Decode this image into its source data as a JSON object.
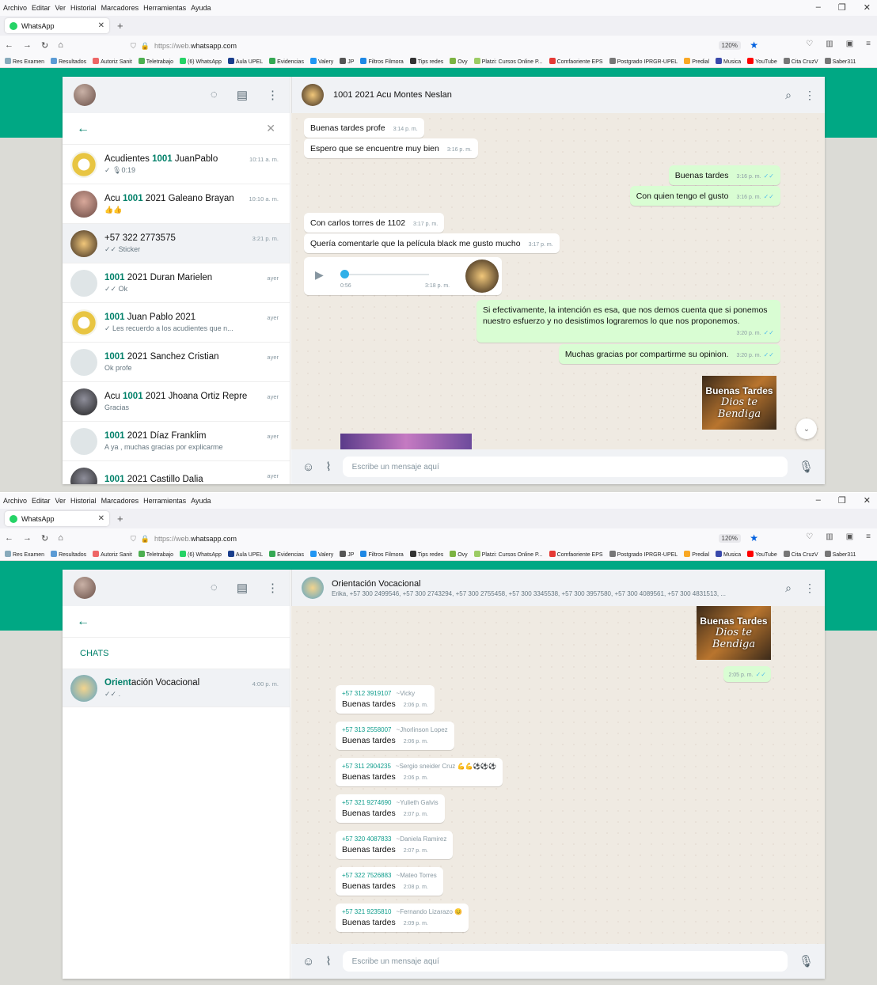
{
  "browser": {
    "menu": [
      "Archivo",
      "Editar",
      "Ver",
      "Historial",
      "Marcadores",
      "Herramientas",
      "Ayuda"
    ],
    "tab_title": "WhatsApp",
    "url_prefix": "https://web.",
    "url_host": "whatsapp.com",
    "zoom": "120%",
    "bookmarks": [
      "Res Examen",
      "Resultados",
      "Autoriz Sanit",
      "Teletrabajo",
      "(6) WhatsApp",
      "Aula UPEL",
      "Evidencias",
      "Valery",
      "JP",
      "Filtros Filmora",
      "Tips redes",
      "Ovy",
      "Platzi: Cursos Online P...",
      "Comfaoriente EPS",
      "Postgrado IPRGR-UPEL",
      "Predial",
      "Musica",
      "YouTube",
      "Cita CruzV",
      "Saber311"
    ]
  },
  "screen1": {
    "chats": [
      {
        "pre": "Acudientes ",
        "hl": "1001",
        "post": " JuanPablo",
        "preview": "✓ 🎙0:19",
        "time": "10:11 a. m.",
        "av": "logo"
      },
      {
        "pre": "Acu ",
        "hl": "1001",
        "post": " 2021 Galeano Brayan",
        "preview": "👍👍",
        "time": "10:10 a. m.",
        "av": "photo"
      },
      {
        "pre": "+57 322 2773575",
        "hl": "",
        "post": "",
        "preview": "✓✓ Sticker",
        "time": "3:21 p. m.",
        "av": "poster",
        "sel": true
      },
      {
        "pre": "",
        "hl": "1001",
        "post": " 2021 Duran Marielen",
        "preview": "✓✓ Ok",
        "time": "ayer",
        "av": "blank"
      },
      {
        "pre": "",
        "hl": "1001",
        "post": " Juan Pablo 2021",
        "preview": "✓ Les recuerdo a los acudientes que n...",
        "time": "ayer",
        "av": "logo"
      },
      {
        "pre": "",
        "hl": "1001",
        "post": " 2021 Sanchez Cristian",
        "preview": "Ok profe",
        "time": "ayer",
        "av": "blank"
      },
      {
        "pre": "Acu ",
        "hl": "1001",
        "post": " 2021 Jhoana Ortiz Repre",
        "preview": "Gracias",
        "time": "ayer",
        "av": "dark"
      },
      {
        "pre": "",
        "hl": "1001",
        "post": " 2021 Díaz Franklim",
        "preview": "A ya , muchas gracias por explicarme",
        "time": "ayer",
        "av": "blank"
      },
      {
        "pre": "",
        "hl": "1001",
        "post": " 2021 Castillo Dalia",
        "preview": "",
        "time": "ayer",
        "av": "dark"
      }
    ],
    "contact": "1001 2021 Acu Montes Neslan",
    "messages": {
      "m1": {
        "text": "Buenas tardes profe",
        "time": "3:14 p. m."
      },
      "m2": {
        "text": "Espero que se encuentre muy bien",
        "time": "3:16 p. m."
      },
      "m3": {
        "text": "Buenas tardes",
        "time": "3:16 p. m."
      },
      "m4": {
        "text": "Con quien tengo el gusto",
        "time": "3:16 p. m."
      },
      "m5": {
        "text": "Con carlos torres de 1102",
        "time": "3:17 p. m."
      },
      "m6": {
        "text": "Quería comentarle que la película black me gusto mucho",
        "time": "3:17 p. m."
      },
      "audio": {
        "duration": "0:56",
        "time": "3:18 p. m."
      },
      "m7": {
        "text": "Si efectivamente, la intención es esa, que nos demos cuenta que si ponemos nuestro esfuerzo y no desistimos lograremos lo que nos proponemos.",
        "time": "3:20 p. m."
      },
      "m8": {
        "text": "Muchas gracias por compartirme su opinion.",
        "time": "3:20 p. m."
      }
    },
    "sticker": {
      "line1": "Buenas Tardes",
      "line2": "Dios te",
      "line3": "Bendiga"
    },
    "compose_placeholder": "Escribe un mensaje aquí"
  },
  "screen2": {
    "chats_label": "CHATS",
    "chat": {
      "hl": "Orient",
      "post": "ación Vocacional",
      "preview": "✓✓ .",
      "time": "4:00 p. m."
    },
    "group_title": "Orientación Vocacional",
    "group_members": "Erika, +57 300 2499546, +57 300 2743294, +57 300 2755458, +57 300 3345538, +57 300 3957580, +57 300 4089561, +57 300 4831513, ...",
    "sticker_time": "2:05 p. m.",
    "messages": [
      {
        "phone": "+57 312 3919107",
        "name": "~Vicky",
        "text": "Buenas tardes",
        "time": "2:06 p. m."
      },
      {
        "phone": "+57 313 2558007",
        "name": "~Jhorlinson Lopez",
        "text": "Buenas  tardes",
        "time": "2:06 p. m."
      },
      {
        "phone": "+57 311 2904235",
        "name": "~Sergio sneider Cruz 💪💪⚽⚽⚽",
        "text": "Buenas tardes",
        "time": "2:06 p. m."
      },
      {
        "phone": "+57 321 9274690",
        "name": "~Yulieth Galvis",
        "text": "Buenas tardes",
        "time": "2:07 p. m."
      },
      {
        "phone": "+57 320 4087833",
        "name": "~Daniela Ramirez",
        "text": "Buenas tardes",
        "time": "2:07 p. m."
      },
      {
        "phone": "+57 322 7526883",
        "name": "~Mateo Torres",
        "text": "Buenas tardes",
        "time": "2:08 p. m."
      },
      {
        "phone": "+57 321 9235810",
        "name": "~Fernando Lizarazo 😊",
        "text": "Buenas tardes",
        "time": "2:09 p. m."
      }
    ],
    "compose_placeholder": "Escribe un mensaje aquí"
  },
  "colors": {
    "brand": "#00a884",
    "out_bubble": "#d9fdd3",
    "highlight": "#008069"
  }
}
